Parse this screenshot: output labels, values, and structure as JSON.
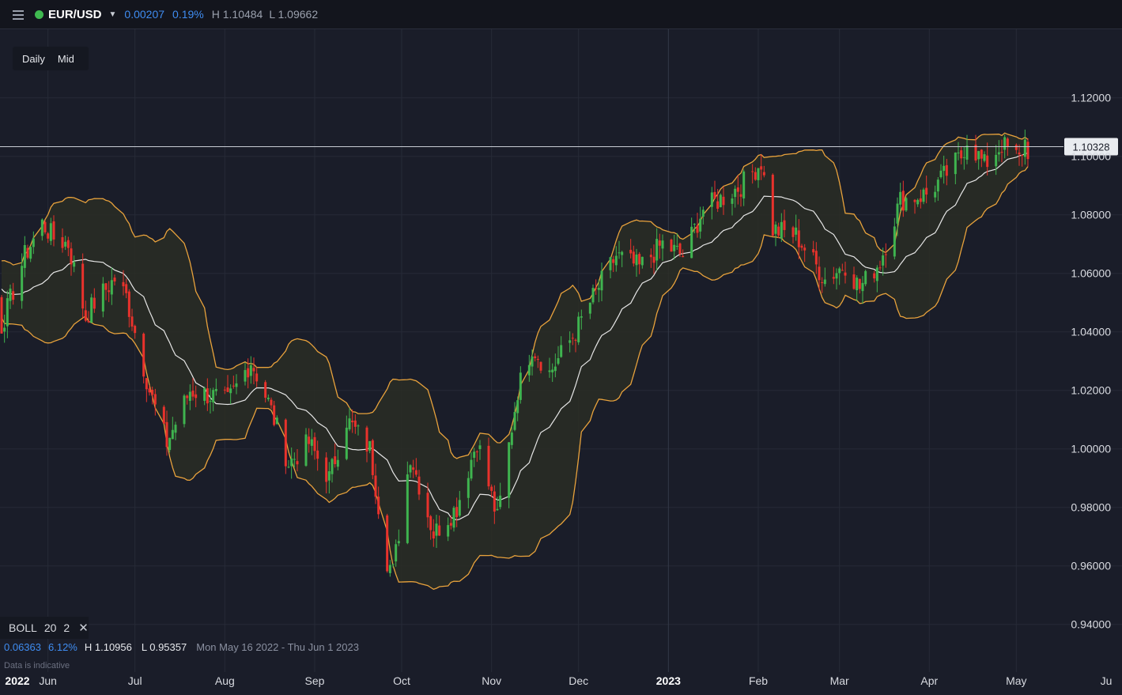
{
  "header": {
    "symbol": "EUR/USD",
    "change": "0.00207",
    "change_pct": "0.19%",
    "high": "H 1.10484",
    "low": "L 1.09662"
  },
  "controls": {
    "interval": "Daily",
    "price_type": "Mid"
  },
  "indicator": {
    "name": "BOLL",
    "period": "20",
    "stddev": "2",
    "close_symbol": "✕"
  },
  "stats": {
    "range": "0.06363",
    "range_pct": "6.12%",
    "high": "H 1.10956",
    "low": "L 0.95357",
    "period": "Mon May 16 2022 - Thu Jun 1 2023"
  },
  "disclaimer": "Data is indicative",
  "current_price_label": "1.10328",
  "colors": {
    "up": "#3fb44f",
    "down": "#e8322c",
    "band": "#e8a23c",
    "middle": "#e6e6e6",
    "status": "#3fb950",
    "accent": "#3f8cf0"
  },
  "chart_data": {
    "type": "candlestick",
    "ylim": [
      0.93,
      1.125
    ],
    "y_ticks": [
      {
        "v": 1.12,
        "label": "1.12000"
      },
      {
        "v": 1.1,
        "label": "1.10000"
      },
      {
        "v": 1.08,
        "label": "1.08000"
      },
      {
        "v": 1.06,
        "label": "1.06000"
      },
      {
        "v": 1.04,
        "label": "1.04000"
      },
      {
        "v": 1.02,
        "label": "1.02000"
      },
      {
        "v": 1.0,
        "label": "1.00000"
      },
      {
        "v": 0.98,
        "label": "0.98000"
      },
      {
        "v": 0.96,
        "label": "0.96000"
      },
      {
        "v": 0.94,
        "label": "0.94000"
      }
    ],
    "x_ticks": [
      {
        "label": "2022",
        "date": "2022-05-15",
        "year": true
      },
      {
        "label": "Jun",
        "date": "2022-06-01"
      },
      {
        "label": "Jul",
        "date": "2022-07-01"
      },
      {
        "label": "Aug",
        "date": "2022-08-01"
      },
      {
        "label": "Sep",
        "date": "2022-09-01"
      },
      {
        "label": "Oct",
        "date": "2022-10-01"
      },
      {
        "label": "Nov",
        "date": "2022-11-01"
      },
      {
        "label": "Dec",
        "date": "2022-12-01"
      },
      {
        "label": "2023",
        "date": "2023-01-01",
        "year": true
      },
      {
        "label": "Feb",
        "date": "2023-02-01"
      },
      {
        "label": "Mar",
        "date": "2023-03-01"
      },
      {
        "label": "Apr",
        "date": "2023-04-01"
      },
      {
        "label": "May",
        "date": "2023-05-01"
      },
      {
        "label": "Ju",
        "date": "2023-06-01"
      }
    ],
    "close_anchors": [
      [
        "2022-05-16",
        1.042
      ],
      [
        "2022-05-24",
        1.066
      ],
      [
        "2022-05-30",
        1.077
      ],
      [
        "2022-06-03",
        1.072
      ],
      [
        "2022-06-08",
        1.07
      ],
      [
        "2022-06-14",
        1.045
      ],
      [
        "2022-06-17",
        1.05
      ],
      [
        "2022-06-24",
        1.058
      ],
      [
        "2022-06-28",
        1.052
      ],
      [
        "2022-07-06",
        1.02
      ],
      [
        "2022-07-12",
        1.002
      ],
      [
        "2022-07-20",
        1.02
      ],
      [
        "2022-07-28",
        1.018
      ],
      [
        "2022-08-02",
        1.016
      ],
      [
        "2022-08-10",
        1.03
      ],
      [
        "2022-08-16",
        1.016
      ],
      [
        "2022-08-23",
        0.995
      ],
      [
        "2022-08-30",
        1.002
      ],
      [
        "2022-09-06",
        0.99
      ],
      [
        "2022-09-12",
        1.01
      ],
      [
        "2022-09-20",
        1.0
      ],
      [
        "2022-09-26",
        0.962
      ],
      [
        "2022-09-28",
        0.958
      ],
      [
        "2022-10-04",
        0.998
      ],
      [
        "2022-10-12",
        0.971
      ],
      [
        "2022-10-20",
        0.98
      ],
      [
        "2022-10-27",
        1.003
      ],
      [
        "2022-11-03",
        0.976
      ],
      [
        "2022-11-10",
        1.02
      ],
      [
        "2022-11-15",
        1.035
      ],
      [
        "2022-11-21",
        1.026
      ],
      [
        "2022-11-30",
        1.04
      ],
      [
        "2022-12-05",
        1.05
      ],
      [
        "2022-12-14",
        1.066
      ],
      [
        "2022-12-22",
        1.062
      ],
      [
        "2022-12-30",
        1.07
      ],
      [
        "2023-01-06",
        1.066
      ],
      [
        "2023-01-13",
        1.082
      ],
      [
        "2023-01-20",
        1.086
      ],
      [
        "2023-01-26",
        1.09
      ],
      [
        "2023-02-02",
        1.098
      ],
      [
        "2023-02-06",
        1.075
      ],
      [
        "2023-02-14",
        1.073
      ],
      [
        "2023-02-24",
        1.058
      ],
      [
        "2023-03-03",
        1.063
      ],
      [
        "2023-03-08",
        1.055
      ],
      [
        "2023-03-15",
        1.064
      ],
      [
        "2023-03-22",
        1.085
      ],
      [
        "2023-03-31",
        1.087
      ],
      [
        "2023-04-05",
        1.092
      ],
      [
        "2023-04-12",
        1.1
      ],
      [
        "2023-04-14",
        1.106
      ],
      [
        "2023-04-20",
        1.097
      ],
      [
        "2023-04-26",
        1.104
      ],
      [
        "2023-05-02",
        1.099
      ],
      [
        "2023-05-04",
        1.105
      ],
      [
        "2023-05-05",
        1.102
      ]
    ],
    "bollinger": {
      "period": 20,
      "stddev": 2
    }
  }
}
